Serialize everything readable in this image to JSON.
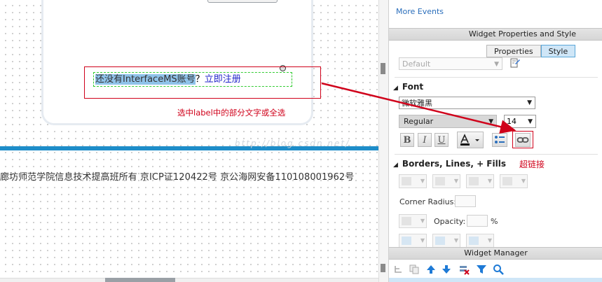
{
  "canvas": {
    "label_selected_text": "还没有InterfaceMS账号",
    "label_plain_text": "？",
    "label_link_text": "立即注册",
    "annotation_select": "选中label中的部分文字或全选",
    "footer_text": "廊坊师范学院信息技术提高班所有  京ICP证120422号  京公海网安备110108001962号",
    "watermark": "http://blog.csdn.net/"
  },
  "panel": {
    "more_events": "More Events",
    "widget_properties_title": "Widget Properties and Style",
    "tabs": [
      {
        "label": "Properties",
        "active": false
      },
      {
        "label": "Style",
        "active": true
      }
    ],
    "style_select": "Default",
    "font_section": "Font",
    "font_family": "微软雅黑",
    "font_weight": "Regular",
    "font_size": "14",
    "bold_label": "B",
    "italic_label": "I",
    "underline_label": "U",
    "annotation_link": "超链接",
    "borders_section": "Borders, Lines, + Fills",
    "corner_radius_label": "Corner Radius:",
    "opacity_label": "Opacity:",
    "opacity_unit": "%",
    "widget_manager_title": "Widget Manager"
  },
  "colors": {
    "annotation_red": "#d0021b",
    "accent_blue": "#1e8dc9",
    "link_blue": "#1f22c9",
    "selection_blue": "#8fc3ea"
  }
}
